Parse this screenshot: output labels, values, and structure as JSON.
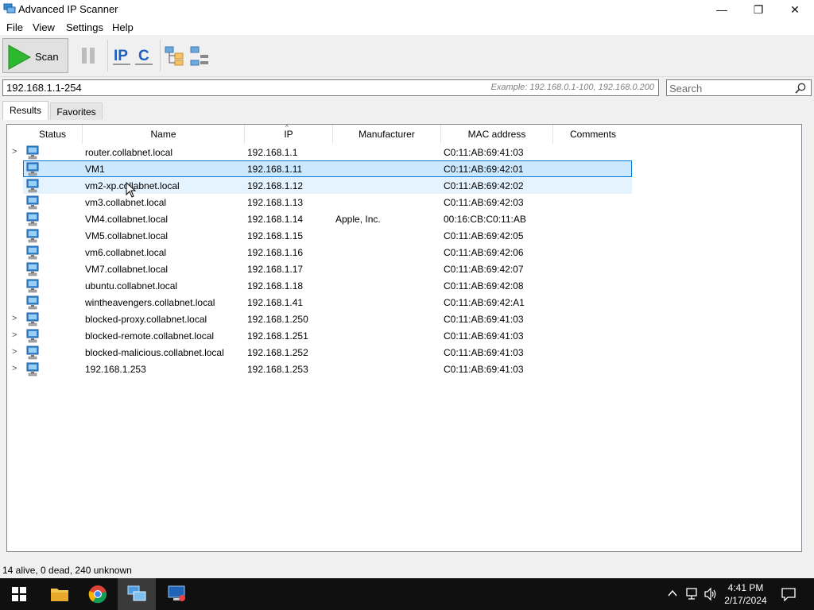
{
  "window": {
    "title": "Advanced IP Scanner",
    "controls": {
      "minimize": "—",
      "restore": "❐",
      "close": "✕"
    }
  },
  "menu": [
    "File",
    "View",
    "Settings",
    "Help"
  ],
  "toolbar": {
    "scan_label": "Scan"
  },
  "address": {
    "value": "192.168.1.1-254",
    "example": "Example: 192.168.0.1-100, 192.168.0.200"
  },
  "search": {
    "placeholder": "Search"
  },
  "tabs": [
    "Results",
    "Favorites"
  ],
  "columns": [
    "Status",
    "Name",
    "IP",
    "Manufacturer",
    "MAC address",
    "Comments"
  ],
  "rows": [
    {
      "expandable": true,
      "name": "router.collabnet.local",
      "ip": "192.168.1.1",
      "manufacturer": "",
      "mac": "C0:11:AB:69:41:03"
    },
    {
      "expandable": false,
      "name": "VM1",
      "ip": "192.168.1.11",
      "manufacturer": "",
      "mac": "C0:11:AB:69:42:01",
      "state": "selected"
    },
    {
      "expandable": false,
      "name": "vm2-xp.collabnet.local",
      "ip": "192.168.1.12",
      "manufacturer": "",
      "mac": "C0:11:AB:69:42:02",
      "state": "hover"
    },
    {
      "expandable": false,
      "name": "vm3.collabnet.local",
      "ip": "192.168.1.13",
      "manufacturer": "",
      "mac": "C0:11:AB:69:42:03"
    },
    {
      "expandable": false,
      "name": "VM4.collabnet.local",
      "ip": "192.168.1.14",
      "manufacturer": "Apple, Inc.",
      "mac": "00:16:CB:C0:11:AB"
    },
    {
      "expandable": false,
      "name": "VM5.collabnet.local",
      "ip": "192.168.1.15",
      "manufacturer": "",
      "mac": "C0:11:AB:69:42:05"
    },
    {
      "expandable": false,
      "name": "vm6.collabnet.local",
      "ip": "192.168.1.16",
      "manufacturer": "",
      "mac": "C0:11:AB:69:42:06"
    },
    {
      "expandable": false,
      "name": "VM7.collabnet.local",
      "ip": "192.168.1.17",
      "manufacturer": "",
      "mac": "C0:11:AB:69:42:07"
    },
    {
      "expandable": false,
      "name": "ubuntu.collabnet.local",
      "ip": "192.168.1.18",
      "manufacturer": "",
      "mac": "C0:11:AB:69:42:08"
    },
    {
      "expandable": false,
      "name": "wintheavengers.collabnet.local",
      "ip": "192.168.1.41",
      "manufacturer": "",
      "mac": "C0:11:AB:69:42:A1"
    },
    {
      "expandable": true,
      "name": "blocked-proxy.collabnet.local",
      "ip": "192.168.1.250",
      "manufacturer": "",
      "mac": "C0:11:AB:69:41:03"
    },
    {
      "expandable": true,
      "name": "blocked-remote.collabnet.local",
      "ip": "192.168.1.251",
      "manufacturer": "",
      "mac": "C0:11:AB:69:41:03"
    },
    {
      "expandable": true,
      "name": "blocked-malicious.collabnet.local",
      "ip": "192.168.1.252",
      "manufacturer": "",
      "mac": "C0:11:AB:69:41:03"
    },
    {
      "expandable": true,
      "name": "192.168.1.253",
      "ip": "192.168.1.253",
      "manufacturer": "",
      "mac": "C0:11:AB:69:41:03"
    }
  ],
  "status": "14 alive, 0 dead, 240 unknown",
  "taskbar": {
    "time": "4:41 PM",
    "date": "2/17/2024"
  },
  "colors": {
    "selected_bg": "#cce8ff",
    "selected_border": "#0078d7",
    "hover_bg": "#e5f3ff",
    "scan_green": "#2eb82e",
    "taskbar": "#101010"
  }
}
